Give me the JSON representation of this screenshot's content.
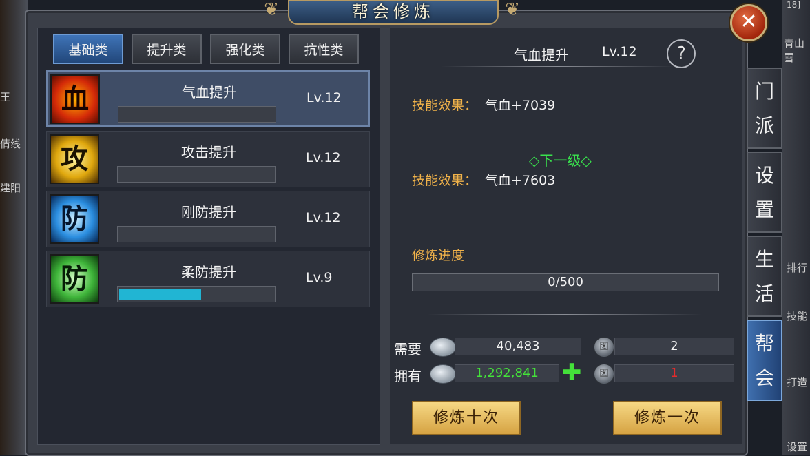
{
  "window": {
    "title": "帮会修炼",
    "corner_tag": "18]",
    "close_symbol": "✕"
  },
  "tabs": [
    {
      "label": "基础类",
      "active": true
    },
    {
      "label": "提升类",
      "active": false
    },
    {
      "label": "强化类",
      "active": false
    },
    {
      "label": "抗性类",
      "active": false
    }
  ],
  "skills": [
    {
      "icon_char": "血",
      "icon_name": "blood-icon",
      "name": "气血提升",
      "level": "Lv.12",
      "progress": 0,
      "selected": true
    },
    {
      "icon_char": "攻",
      "icon_name": "attack-icon",
      "name": "攻击提升",
      "level": "Lv.12",
      "progress": 0,
      "selected": false
    },
    {
      "icon_char": "防",
      "icon_name": "physical-defense-icon",
      "name": "刚防提升",
      "level": "Lv.12",
      "progress": 0,
      "selected": false
    },
    {
      "icon_char": "防",
      "icon_name": "magic-defense-icon",
      "name": "柔防提升",
      "level": "Lv.9",
      "progress": 0.53,
      "selected": false
    }
  ],
  "detail": {
    "title": "气血提升",
    "level": "Lv.12",
    "help_symbol": "?",
    "current_effect_label": "技能效果：",
    "current_effect_value": "气血+7039",
    "next_level_label": "◇下一级◇",
    "next_effect_label": "技能效果：",
    "next_effect_value": "气血+7603",
    "progress_label": "修炼进度",
    "progress_text": "0/500",
    "progress_fraction": 0
  },
  "resources": {
    "need_label": "需要",
    "have_label": "拥有",
    "need_silver": "40,483",
    "have_silver": "1,292,841",
    "need_item": "2",
    "have_item": "1",
    "item_icon_text": "图",
    "plus_symbol": "✚",
    "colors": {
      "have_silver": "#44e13a",
      "have_item": "#e32b2b"
    }
  },
  "buttons": {
    "train_ten": "修炼十次",
    "train_once": "修炼一次"
  },
  "side_tabs": [
    {
      "chars": [
        "门",
        "派"
      ],
      "active": false
    },
    {
      "chars": [
        "设",
        "置"
      ],
      "active": false
    },
    {
      "chars": [
        "生",
        "活"
      ],
      "active": false
    },
    {
      "chars": [
        "帮",
        "会"
      ],
      "active": true
    }
  ],
  "background_text": {
    "left_1": "王",
    "left_2": "倩线",
    "left_3": "建阳",
    "right_1": "青山 雪",
    "right_2": "排行",
    "right_3": "技能",
    "right_4": "打造",
    "right_5": "设置"
  },
  "colors": {
    "accent_blue": "#21b5d3",
    "effect_label": "#f0b24a",
    "next_level": "#39e34d",
    "button_gold": "#e9c06a"
  }
}
